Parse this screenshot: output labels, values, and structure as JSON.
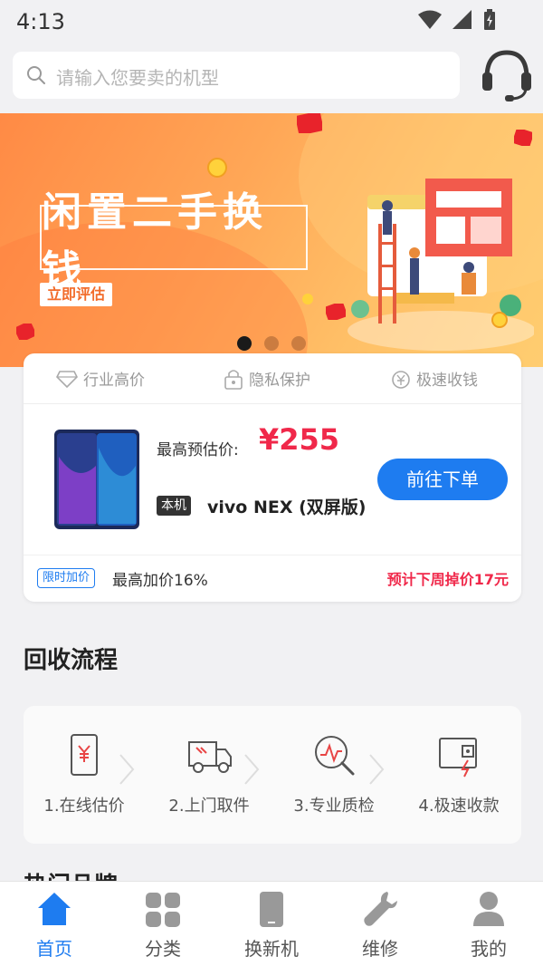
{
  "status_bar": {
    "time": "4:13"
  },
  "search": {
    "placeholder": "请输入您要卖的机型"
  },
  "banner": {
    "title": "闲置二手换钱",
    "cta": "立即评估",
    "slide_count": 3,
    "active_slide": 0
  },
  "features": [
    {
      "icon": "diamond-icon",
      "label": "行业高价"
    },
    {
      "icon": "lock-icon",
      "label": "隐私保护"
    },
    {
      "icon": "yen-speed-icon",
      "label": "极速收钱"
    }
  ],
  "quote": {
    "price_label": "最高预估价:",
    "price": "¥255",
    "badge": "本机",
    "model": "vivo NEX (双屏版)",
    "order_button": "前往下单",
    "limit_tag": "限时加价",
    "markup": "最高加价16%",
    "drop_notice": "预计下周掉价17元"
  },
  "process": {
    "title": "回收流程",
    "steps": [
      {
        "icon": "phone-yen-icon",
        "label": "1.在线估价"
      },
      {
        "icon": "truck-icon",
        "label": "2.上门取件"
      },
      {
        "icon": "magnifier-check-icon",
        "label": "3.专业质检"
      },
      {
        "icon": "wallet-fast-icon",
        "label": "4.极速收款"
      }
    ]
  },
  "hot_brands": {
    "title": "热门品牌"
  },
  "nav": [
    {
      "icon": "home-icon",
      "label": "首页",
      "active": true
    },
    {
      "icon": "category-icon",
      "label": "分类",
      "active": false
    },
    {
      "icon": "phone-icon",
      "label": "换新机",
      "active": false
    },
    {
      "icon": "wrench-icon",
      "label": "维修",
      "active": false
    },
    {
      "icon": "user-icon",
      "label": "我的",
      "active": false
    }
  ],
  "colors": {
    "accent": "#1e7cf0",
    "price": "#f0284a",
    "banner": "#ffa656"
  }
}
